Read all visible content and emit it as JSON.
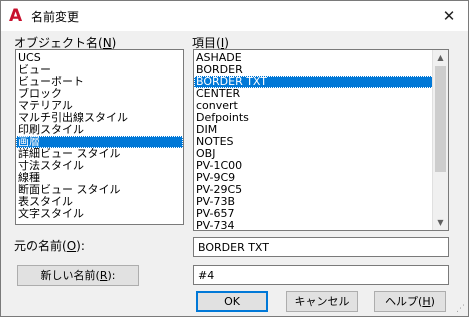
{
  "window": {
    "title": "名前変更",
    "app_icon_glyph": "A",
    "close_glyph": "✕"
  },
  "object_names": {
    "label_prefix": "オブジェクト名(",
    "label_key": "N",
    "label_suffix": ")",
    "items": [
      "UCS",
      "ビュー",
      "ビューポート",
      "ブロック",
      "マテリアル",
      "マルチ引出線スタイル",
      "印刷スタイル",
      "画層",
      "詳細ビュー スタイル",
      "寸法スタイル",
      "線種",
      "断面ビュー スタイル",
      "表スタイル",
      "文字スタイル"
    ],
    "selected_index": 7
  },
  "items": {
    "label_prefix": "項目(",
    "label_key": "I",
    "label_suffix": ")",
    "items": [
      "ASHADE",
      "BORDER",
      "BORDER TXT",
      "CENTER",
      "convert",
      "Defpoints",
      "DIM",
      "NOTES",
      "OBJ",
      "PV-1C00",
      "PV-9C9",
      "PV-29C5",
      "PV-73B",
      "PV-657",
      "PV-734"
    ],
    "selected_index": 2
  },
  "old_name": {
    "label_prefix": "元の名前(",
    "label_key": "O",
    "label_suffix": "):",
    "value": "BORDER TXT"
  },
  "new_name": {
    "button_prefix": "新しい名前(",
    "button_key": "R",
    "button_suffix": "):",
    "value": "#4"
  },
  "buttons": {
    "ok": "OK",
    "cancel": "キャンセル",
    "help_prefix": "ヘルプ(",
    "help_key": "H",
    "help_suffix": ")"
  },
  "scroll": {
    "up_glyph": "▲",
    "down_glyph": "▼"
  },
  "colors": {
    "selection": "#0078d7",
    "app_icon": "#c8102e"
  }
}
